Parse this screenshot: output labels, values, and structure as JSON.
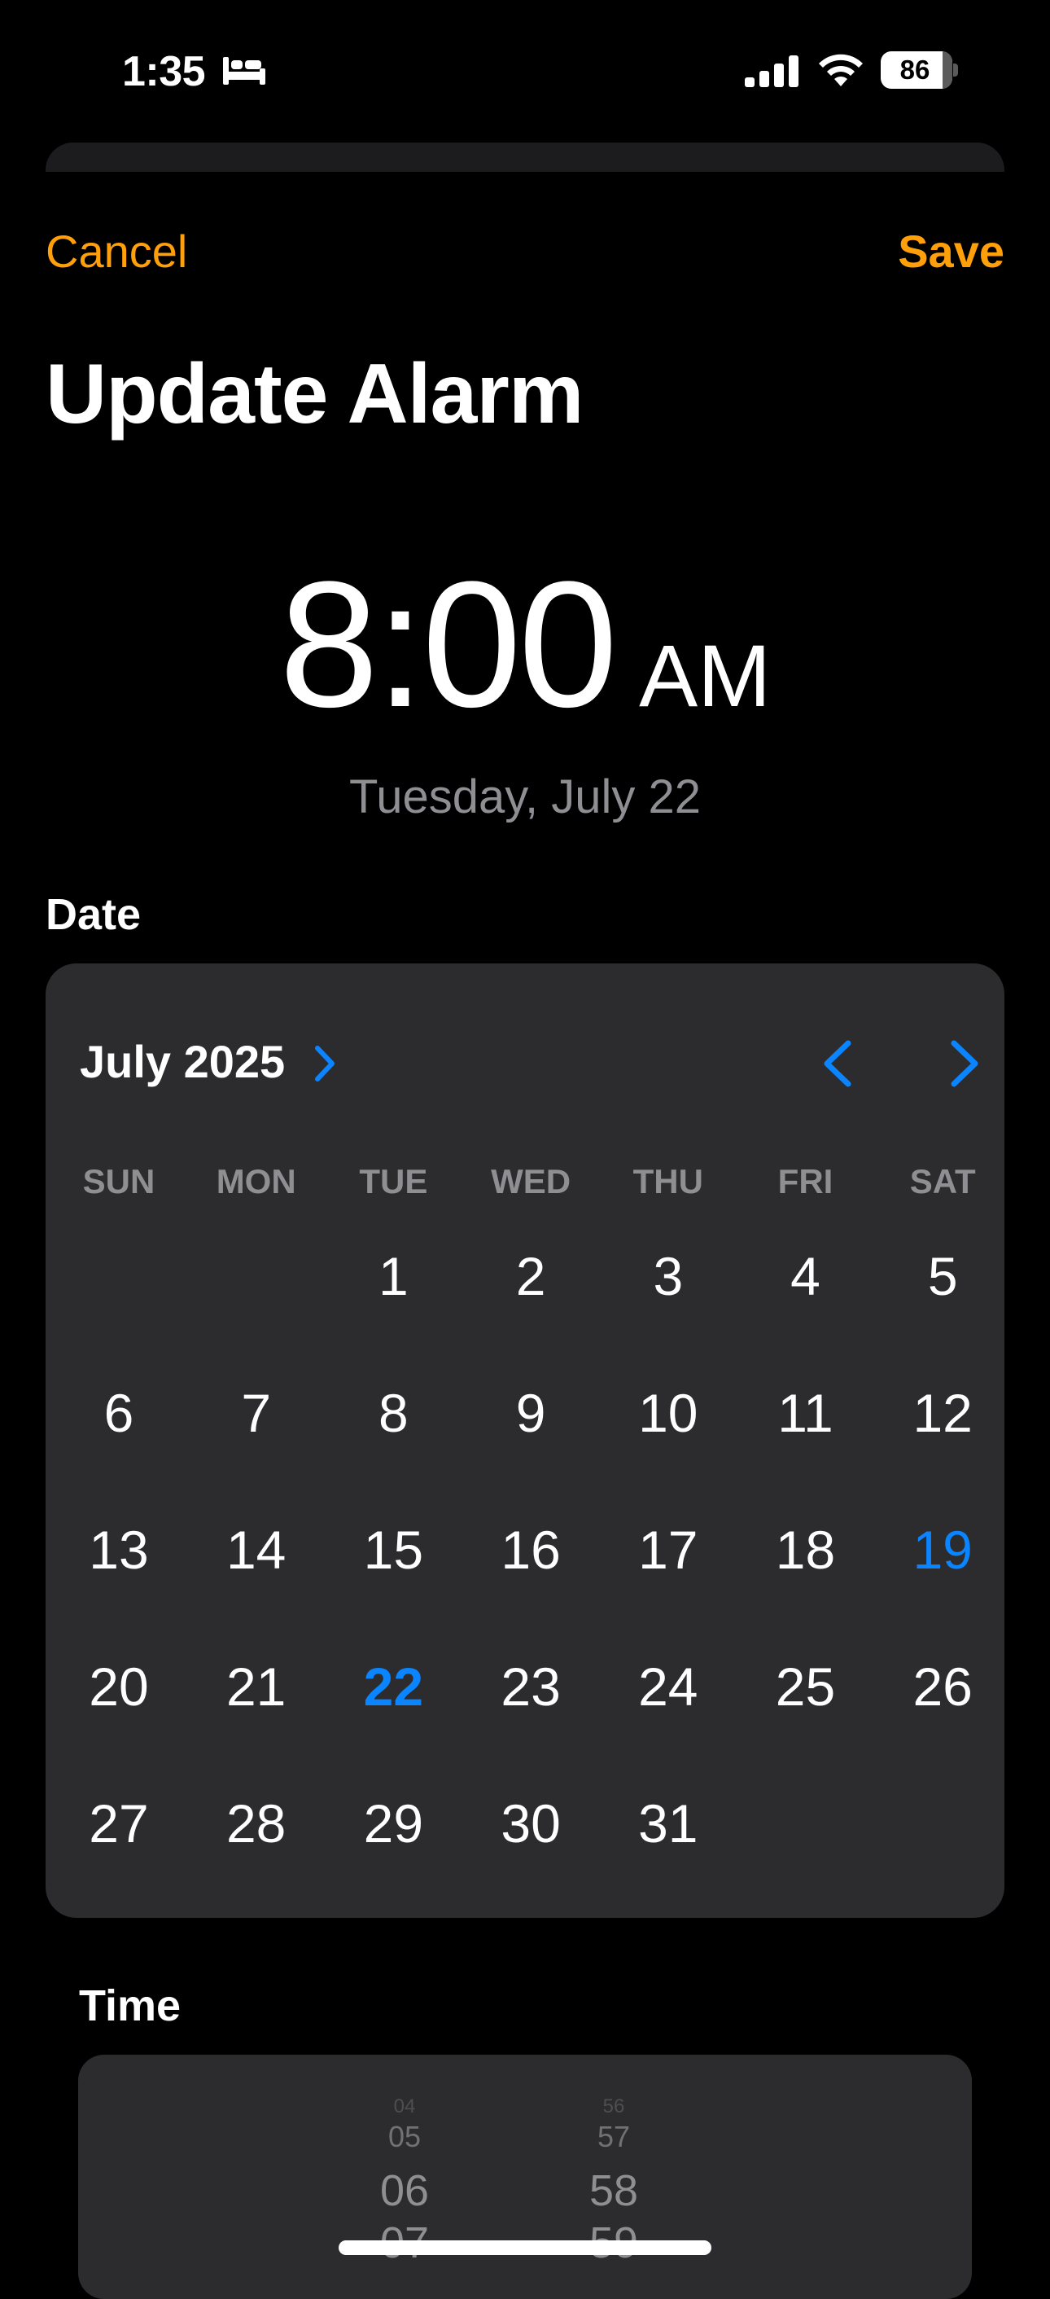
{
  "status_bar": {
    "time": "1:35",
    "battery": "86"
  },
  "nav": {
    "cancel": "Cancel",
    "save": "Save"
  },
  "page": {
    "title": "Update Alarm",
    "time": "8:00",
    "ampm": "AM",
    "date_subtitle": "Tuesday, July 22"
  },
  "date_section": {
    "label": "Date",
    "month_title": "July 2025",
    "weekdays": [
      "SUN",
      "MON",
      "TUE",
      "WED",
      "THU",
      "FRI",
      "SAT"
    ],
    "first_weekday_index": 2,
    "days_in_month": 31,
    "today": 19,
    "selected": 22
  },
  "time_section": {
    "label": "Time",
    "hours_wheel": [
      "04",
      "05",
      "06",
      "07"
    ],
    "minutes_wheel": [
      "56",
      "57",
      "58",
      "59"
    ]
  },
  "colors": {
    "accent_orange": "#ff9f0a",
    "accent_blue": "#0a84ff"
  }
}
